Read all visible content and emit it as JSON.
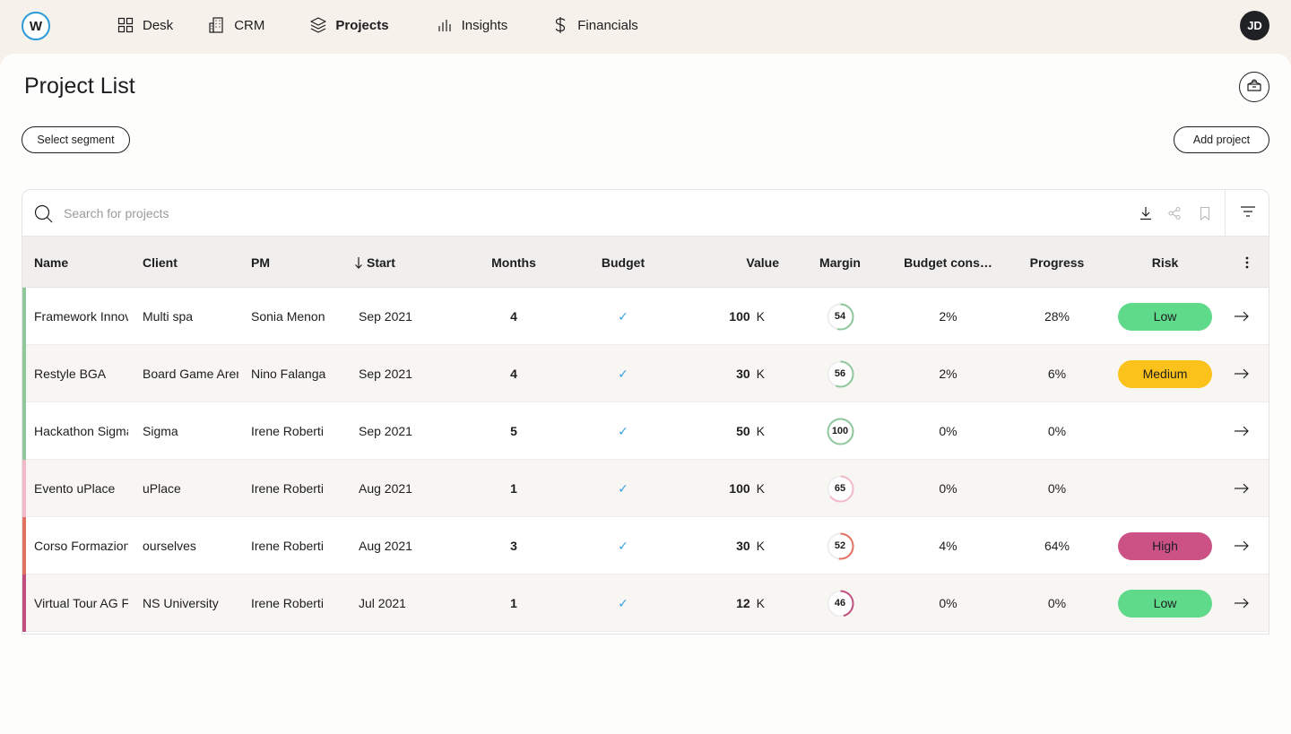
{
  "app": {
    "logo_letter": "W",
    "user_initials": "JD"
  },
  "nav": [
    {
      "label": "Desk",
      "icon": "grid-icon",
      "active": false
    },
    {
      "label": "CRM",
      "icon": "building-icon",
      "active": false
    },
    {
      "label": "Projects",
      "icon": "layers-icon",
      "active": true
    },
    {
      "label": "Insights",
      "icon": "bar-chart-icon",
      "active": false
    },
    {
      "label": "Financials",
      "icon": "dollar-icon",
      "active": false
    }
  ],
  "page": {
    "title": "Project List",
    "select_segment_label": "Select segment",
    "add_project_label": "Add project"
  },
  "search": {
    "placeholder": "Search for projects",
    "value": ""
  },
  "table": {
    "columns": [
      "Name",
      "Client",
      "PM",
      "Start",
      "Months",
      "Budget",
      "Value",
      "Margin",
      "Budget cons…",
      "Progress",
      "Risk"
    ],
    "sort_column": "Start",
    "sort_direction": "desc",
    "rows": [
      {
        "name": "Framework Innovation",
        "client": "Multi spa",
        "pm": "Sonia Menon",
        "start": "Sep 2021",
        "months": "4",
        "budget": "✓",
        "value": "100",
        "value_unit": "K",
        "margin": "54",
        "budget_cons": "2%",
        "progress": "28%",
        "risk": "Low",
        "accent": "#8fc99b",
        "ring": "#8fc99b"
      },
      {
        "name": "Restyle BGA",
        "client": "Board Game Arena",
        "pm": "Nino Falanga",
        "start": "Sep 2021",
        "months": "4",
        "budget": "✓",
        "value": "30",
        "value_unit": "K",
        "margin": "56",
        "budget_cons": "2%",
        "progress": "6%",
        "risk": "Medium",
        "accent": "#8fc99b",
        "ring": "#8fc99b"
      },
      {
        "name": "Hackathon Sigma",
        "client": "Sigma",
        "pm": "Irene Roberti",
        "start": "Sep 2021",
        "months": "5",
        "budget": "✓",
        "value": "50",
        "value_unit": "K",
        "margin": "100",
        "budget_cons": "0%",
        "progress": "0%",
        "risk": "",
        "accent": "#8fc99b",
        "ring": "#8fc99b"
      },
      {
        "name": "Evento uPlace",
        "client": "uPlace",
        "pm": "Irene Roberti",
        "start": "Aug 2021",
        "months": "1",
        "budget": "✓",
        "value": "100",
        "value_unit": "K",
        "margin": "65",
        "budget_cons": "0%",
        "progress": "0%",
        "risk": "",
        "accent": "#f4b9c9",
        "ring": "#f4b9c9"
      },
      {
        "name": "Corso Formazione",
        "client": "ourselves",
        "pm": "Irene Roberti",
        "start": "Aug 2021",
        "months": "3",
        "budget": "✓",
        "value": "30",
        "value_unit": "K",
        "margin": "52",
        "budget_cons": "4%",
        "progress": "64%",
        "risk": "High",
        "accent": "#e2725f",
        "ring": "#e2725f"
      },
      {
        "name": "Virtual Tour AG Fair",
        "client": "NS University",
        "pm": "Irene Roberti",
        "start": "Jul 2021",
        "months": "1",
        "budget": "✓",
        "value": "12",
        "value_unit": "K",
        "margin": "46",
        "budget_cons": "0%",
        "progress": "0%",
        "risk": "Low",
        "accent": "#c04f7d",
        "ring": "#c04f7d"
      }
    ]
  },
  "colors": {
    "risk_low": "#5fd98a",
    "risk_medium": "#fcc21c",
    "risk_high": "#cc5286",
    "check": "#3aa0e0",
    "logo_ring": "#2a9bd6"
  }
}
